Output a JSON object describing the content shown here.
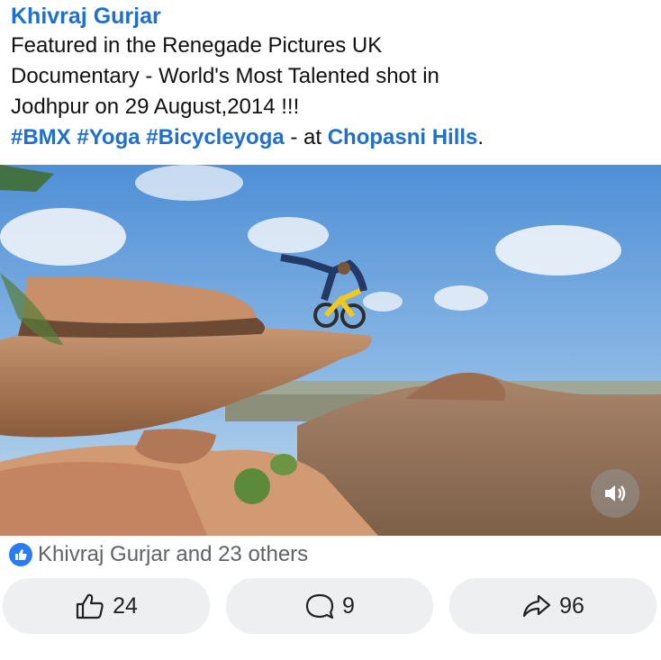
{
  "post": {
    "author": "Khivraj Gurjar",
    "caption_lines": [
      "Featured in the Renegade Pictures UK",
      "Documentary - World's Most Talented shot in",
      "Jodhpur on 29 August,2014 !!!"
    ],
    "hashtags": [
      "#BMX",
      "#Yoga",
      "#Bicycleyoga"
    ],
    "location_prefix": " - at ",
    "location": "Chopasni Hills",
    "location_suffix": "."
  },
  "video": {
    "volume_icon": "speaker-volume-icon"
  },
  "reactions": {
    "icon": "thumbs-up-icon",
    "text": "Khivraj Gurjar and 23 others"
  },
  "actions": {
    "like_count": "24",
    "comment_count": "9",
    "share_count": "96"
  },
  "colors": {
    "link_blue": "#1f6fcf",
    "like_blue": "#2a7cf0",
    "button_bg": "#eeeff1"
  }
}
